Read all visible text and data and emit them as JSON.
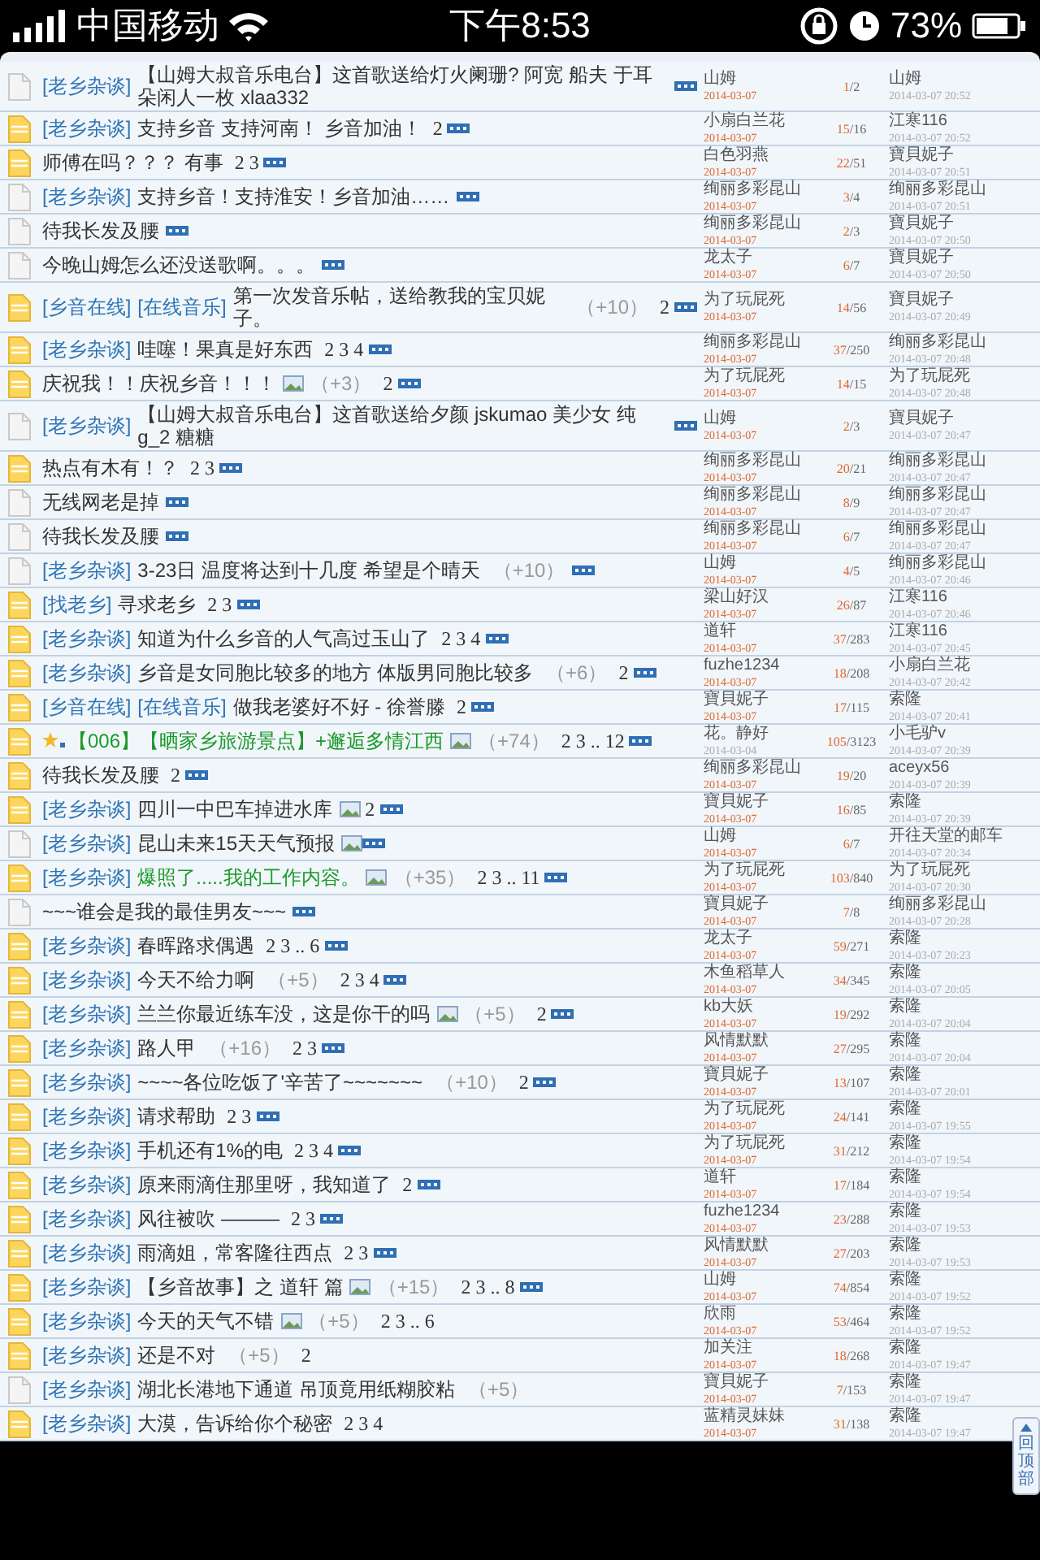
{
  "status_bar": {
    "carrier": "中国移动",
    "time": "下午8:53",
    "battery": "73%"
  },
  "rows": [
    {
      "kind": "plain",
      "tags": [
        "[老乡杂谈]"
      ],
      "title": "【山姆大叔音乐电台】这首歌送给灯火阑珊? 阿宽 船夫 于耳朵闲人一枚 xlaa332",
      "highlight": false,
      "starred": false,
      "image": false,
      "bonus": "",
      "pages": "",
      "new": true,
      "author": "山姆",
      "recent": true,
      "author_date": "2014-03-07",
      "counts": "1/2",
      "last_user": "山姆",
      "last_time": "2014-03-07 20:52"
    },
    {
      "kind": "hot",
      "tags": [
        "[老乡杂谈]"
      ],
      "title": "支持乡音 支持河南！ 乡音加油！",
      "highlight": false,
      "starred": false,
      "image": false,
      "bonus": "",
      "pages": "2",
      "new": true,
      "author": "小扇白兰花",
      "recent": true,
      "author_date": "2014-03-07",
      "counts": "15/16",
      "last_user": "江寒116",
      "last_time": "2014-03-07 20:52"
    },
    {
      "kind": "hot",
      "tags": [],
      "title": "师傅在吗？？？ 有事",
      "highlight": false,
      "starred": false,
      "image": false,
      "bonus": "",
      "pages": "2 3",
      "new": true,
      "author": "白色羽燕",
      "recent": true,
      "author_date": "2014-03-07",
      "counts": "22/51",
      "last_user": "寶貝妮子",
      "last_time": "2014-03-07 20:51"
    },
    {
      "kind": "plain",
      "tags": [
        "[老乡杂谈]"
      ],
      "title": "支持乡音！支持淮安！乡音加油……",
      "highlight": false,
      "starred": false,
      "image": false,
      "bonus": "",
      "pages": "",
      "new": true,
      "author": "绚丽多彩昆山",
      "recent": true,
      "author_date": "2014-03-07",
      "counts": "3/4",
      "last_user": "绚丽多彩昆山",
      "last_time": "2014-03-07 20:51"
    },
    {
      "kind": "plain",
      "tags": [],
      "title": "待我长发及腰",
      "highlight": false,
      "starred": false,
      "image": false,
      "bonus": "",
      "pages": "",
      "new": true,
      "author": "绚丽多彩昆山",
      "recent": true,
      "author_date": "2014-03-07",
      "counts": "2/3",
      "last_user": "寶貝妮子",
      "last_time": "2014-03-07 20:50"
    },
    {
      "kind": "plain",
      "tags": [],
      "title": "今晚山姆怎么还没送歌啊。。。",
      "highlight": false,
      "starred": false,
      "image": false,
      "bonus": "",
      "pages": "",
      "new": true,
      "author": "龙太子",
      "recent": true,
      "author_date": "2014-03-07",
      "counts": "6/7",
      "last_user": "寶貝妮子",
      "last_time": "2014-03-07 20:50"
    },
    {
      "kind": "hot",
      "tags": [
        "[乡音在线]",
        "[在线音乐]"
      ],
      "title": "第一次发音乐帖，送给教我的宝贝妮子。",
      "highlight": false,
      "starred": false,
      "image": false,
      "bonus": "（+10）",
      "pages": "2",
      "new": true,
      "author": "为了玩屁死",
      "recent": true,
      "author_date": "2014-03-07",
      "counts": "14/56",
      "last_user": "寶貝妮子",
      "last_time": "2014-03-07 20:49"
    },
    {
      "kind": "hot",
      "tags": [
        "[老乡杂谈]"
      ],
      "title": "哇噻！果真是好东西",
      "highlight": false,
      "starred": false,
      "image": false,
      "bonus": "",
      "pages": "2 3 4",
      "new": true,
      "author": "绚丽多彩昆山",
      "recent": true,
      "author_date": "2014-03-07",
      "counts": "37/250",
      "last_user": "绚丽多彩昆山",
      "last_time": "2014-03-07 20:48"
    },
    {
      "kind": "hot",
      "tags": [],
      "title": "庆祝我！！庆祝乡音！！！",
      "highlight": false,
      "starred": false,
      "image": true,
      "bonus": "（+3）",
      "pages": "2",
      "new": true,
      "author": "为了玩屁死",
      "recent": true,
      "author_date": "2014-03-07",
      "counts": "14/15",
      "last_user": "为了玩屁死",
      "last_time": "2014-03-07 20:48"
    },
    {
      "kind": "plain",
      "tags": [
        "[老乡杂谈]"
      ],
      "title": "【山姆大叔音乐电台】这首歌送给夕颜 jskumao 美少女 纯g_2 糖糖",
      "highlight": false,
      "starred": false,
      "image": false,
      "bonus": "",
      "pages": "",
      "new": true,
      "author": "山姆",
      "recent": true,
      "author_date": "2014-03-07",
      "counts": "2/3",
      "last_user": "寶貝妮子",
      "last_time": "2014-03-07 20:47"
    },
    {
      "kind": "hot",
      "tags": [],
      "title": "热点有木有！？",
      "highlight": false,
      "starred": false,
      "image": false,
      "bonus": "",
      "pages": "2 3",
      "new": true,
      "author": "绚丽多彩昆山",
      "recent": true,
      "author_date": "2014-03-07",
      "counts": "20/21",
      "last_user": "绚丽多彩昆山",
      "last_time": "2014-03-07 20:47"
    },
    {
      "kind": "plain",
      "tags": [],
      "title": "无线网老是掉",
      "highlight": false,
      "starred": false,
      "image": false,
      "bonus": "",
      "pages": "",
      "new": true,
      "author": "绚丽多彩昆山",
      "recent": true,
      "author_date": "2014-03-07",
      "counts": "8/9",
      "last_user": "绚丽多彩昆山",
      "last_time": "2014-03-07 20:47"
    },
    {
      "kind": "plain",
      "tags": [],
      "title": "待我长发及腰",
      "highlight": false,
      "starred": false,
      "image": false,
      "bonus": "",
      "pages": "",
      "new": true,
      "author": "绚丽多彩昆山",
      "recent": true,
      "author_date": "2014-03-07",
      "counts": "6/7",
      "last_user": "绚丽多彩昆山",
      "last_time": "2014-03-07 20:47"
    },
    {
      "kind": "plain",
      "tags": [
        "[老乡杂谈]"
      ],
      "title": "3-23日 温度将达到十几度 希望是个晴天",
      "highlight": false,
      "starred": false,
      "image": false,
      "bonus": "（+10）",
      "pages": "",
      "new": true,
      "author": "山姆",
      "recent": true,
      "author_date": "2014-03-07",
      "counts": "4/5",
      "last_user": "绚丽多彩昆山",
      "last_time": "2014-03-07 20:46"
    },
    {
      "kind": "hot",
      "tags": [
        "[找老乡]"
      ],
      "title": "寻求老乡",
      "highlight": false,
      "starred": false,
      "image": false,
      "bonus": "",
      "pages": "2 3",
      "new": true,
      "author": "梁山好汉",
      "recent": true,
      "author_date": "2014-03-07",
      "counts": "26/87",
      "last_user": "江寒116",
      "last_time": "2014-03-07 20:46"
    },
    {
      "kind": "hot",
      "tags": [
        "[老乡杂谈]"
      ],
      "title": "知道为什么乡音的人气高过玉山了",
      "highlight": false,
      "starred": false,
      "image": false,
      "bonus": "",
      "pages": "2 3 4",
      "new": true,
      "author": "道轩",
      "recent": true,
      "author_date": "2014-03-07",
      "counts": "37/283",
      "last_user": "江寒116",
      "last_time": "2014-03-07 20:45"
    },
    {
      "kind": "hot",
      "tags": [
        "[老乡杂谈]"
      ],
      "title": "乡音是女同胞比较多的地方 体版男同胞比较多",
      "highlight": false,
      "starred": false,
      "image": false,
      "bonus": "（+6）",
      "pages": "2",
      "new": true,
      "author": "fuzhe1234",
      "recent": true,
      "author_date": "2014-03-07",
      "counts": "18/208",
      "last_user": "小扇白兰花",
      "last_time": "2014-03-07 20:42"
    },
    {
      "kind": "hot",
      "tags": [
        "[乡音在线]",
        "[在线音乐]"
      ],
      "title": "做我老婆好不好 - 徐誉滕",
      "highlight": false,
      "starred": false,
      "image": false,
      "bonus": "",
      "pages": "2",
      "new": true,
      "author": "寶貝妮子",
      "recent": true,
      "author_date": "2014-03-07",
      "counts": "17/115",
      "last_user": "索隆",
      "last_time": "2014-03-07 20:41"
    },
    {
      "kind": "hot",
      "tags": [],
      "title": "【006】【晒家乡旅游景点】+邂逅多情江西",
      "highlight": true,
      "starred": true,
      "image": true,
      "bonus": "（+74）",
      "pages": "2 3 .. 12",
      "new": true,
      "author": "花。静好",
      "recent": false,
      "author_date": "2014-03-04",
      "counts": "105/3123",
      "last_user": "小毛驴v",
      "last_time": "2014-03-07 20:39"
    },
    {
      "kind": "hot",
      "tags": [],
      "title": "待我长发及腰",
      "highlight": false,
      "starred": false,
      "image": false,
      "bonus": "",
      "pages": "2",
      "new": true,
      "author": "绚丽多彩昆山",
      "recent": true,
      "author_date": "2014-03-07",
      "counts": "19/20",
      "last_user": "aceyx56",
      "last_time": "2014-03-07 20:39"
    },
    {
      "kind": "hot",
      "tags": [
        "[老乡杂谈]"
      ],
      "title": "四川一中巴车掉进水库",
      "highlight": false,
      "starred": false,
      "image": true,
      "bonus": "",
      "pages": "2",
      "new": true,
      "author": "寶貝妮子",
      "recent": true,
      "author_date": "2014-03-07",
      "counts": "16/85",
      "last_user": "索隆",
      "last_time": "2014-03-07 20:39"
    },
    {
      "kind": "plain",
      "tags": [
        "[老乡杂谈]"
      ],
      "title": "昆山未来15天天气预报",
      "highlight": false,
      "starred": false,
      "image": true,
      "bonus": "",
      "pages": "",
      "new": true,
      "author": "山姆",
      "recent": true,
      "author_date": "2014-03-07",
      "counts": "6/7",
      "last_user": "开往天堂的邮车",
      "last_time": "2014-03-07 20:34"
    },
    {
      "kind": "hot",
      "tags": [
        "[老乡杂谈]"
      ],
      "title": "爆照了.....我的工作内容。",
      "highlight": true,
      "starred": false,
      "image": true,
      "bonus": "（+35）",
      "pages": "2 3 .. 11",
      "new": true,
      "author": "为了玩屁死",
      "recent": true,
      "author_date": "2014-03-07",
      "counts": "103/840",
      "last_user": "为了玩屁死",
      "last_time": "2014-03-07 20:30"
    },
    {
      "kind": "plain",
      "tags": [],
      "title": "~~~谁会是我的最佳男友~~~",
      "highlight": false,
      "starred": false,
      "image": false,
      "bonus": "",
      "pages": "",
      "new": true,
      "author": "寶貝妮子",
      "recent": true,
      "author_date": "2014-03-07",
      "counts": "7/8",
      "last_user": "绚丽多彩昆山",
      "last_time": "2014-03-07 20:28"
    },
    {
      "kind": "hot",
      "tags": [
        "[老乡杂谈]"
      ],
      "title": "春晖路求偶遇",
      "highlight": false,
      "starred": false,
      "image": false,
      "bonus": "",
      "pages": "2 3 .. 6",
      "new": true,
      "author": "龙太子",
      "recent": true,
      "author_date": "2014-03-07",
      "counts": "59/271",
      "last_user": "索隆",
      "last_time": "2014-03-07 20:23"
    },
    {
      "kind": "hot",
      "tags": [
        "[老乡杂谈]"
      ],
      "title": "今天不给力啊",
      "highlight": false,
      "starred": false,
      "image": false,
      "bonus": "（+5）",
      "pages": "2 3 4",
      "new": true,
      "author": "木鱼稻草人",
      "recent": true,
      "author_date": "2014-03-07",
      "counts": "34/345",
      "last_user": "索隆",
      "last_time": "2014-03-07 20:05"
    },
    {
      "kind": "hot",
      "tags": [
        "[老乡杂谈]"
      ],
      "title": "兰兰你最近练车没，这是你干的吗",
      "highlight": false,
      "starred": false,
      "image": true,
      "bonus": "（+5）",
      "pages": "2",
      "new": true,
      "author": "kb大妖",
      "recent": true,
      "author_date": "2014-03-07",
      "counts": "19/292",
      "last_user": "索隆",
      "last_time": "2014-03-07 20:04"
    },
    {
      "kind": "hot",
      "tags": [
        "[老乡杂谈]"
      ],
      "title": "路人甲",
      "highlight": false,
      "starred": false,
      "image": false,
      "bonus": "（+16）",
      "pages": "2 3",
      "new": true,
      "author": "风情默默",
      "recent": true,
      "author_date": "2014-03-07",
      "counts": "27/295",
      "last_user": "索隆",
      "last_time": "2014-03-07 20:04"
    },
    {
      "kind": "hot",
      "tags": [
        "[老乡杂谈]"
      ],
      "title": "~~~~各位吃饭了'辛苦了~~~~~~~",
      "highlight": false,
      "starred": false,
      "image": false,
      "bonus": "（+10）",
      "pages": "2",
      "new": true,
      "author": "寶貝妮子",
      "recent": true,
      "author_date": "2014-03-07",
      "counts": "13/107",
      "last_user": "索隆",
      "last_time": "2014-03-07 20:01"
    },
    {
      "kind": "hot",
      "tags": [
        "[老乡杂谈]"
      ],
      "title": "请求帮助",
      "highlight": false,
      "starred": false,
      "image": false,
      "bonus": "",
      "pages": "2 3",
      "new": true,
      "author": "为了玩屁死",
      "recent": true,
      "author_date": "2014-03-07",
      "counts": "24/141",
      "last_user": "索隆",
      "last_time": "2014-03-07 19:55"
    },
    {
      "kind": "hot",
      "tags": [
        "[老乡杂谈]"
      ],
      "title": "手机还有1%的电",
      "highlight": false,
      "starred": false,
      "image": false,
      "bonus": "",
      "pages": "2 3 4",
      "new": true,
      "author": "为了玩屁死",
      "recent": true,
      "author_date": "2014-03-07",
      "counts": "31/212",
      "last_user": "索隆",
      "last_time": "2014-03-07 19:54"
    },
    {
      "kind": "hot",
      "tags": [
        "[老乡杂谈]"
      ],
      "title": "原来雨滴住那里呀，我知道了",
      "highlight": false,
      "starred": false,
      "image": false,
      "bonus": "",
      "pages": "2",
      "new": true,
      "author": "道轩",
      "recent": true,
      "author_date": "2014-03-07",
      "counts": "17/184",
      "last_user": "索隆",
      "last_time": "2014-03-07 19:54"
    },
    {
      "kind": "hot",
      "tags": [
        "[老乡杂谈]"
      ],
      "title": "风往被吹 ———",
      "highlight": false,
      "starred": false,
      "image": false,
      "bonus": "",
      "pages": "2 3",
      "new": true,
      "author": "fuzhe1234",
      "recent": true,
      "author_date": "2014-03-07",
      "counts": "23/288",
      "last_user": "索隆",
      "last_time": "2014-03-07 19:53"
    },
    {
      "kind": "hot",
      "tags": [
        "[老乡杂谈]"
      ],
      "title": "雨滴姐，常客隆往西点",
      "highlight": false,
      "starred": false,
      "image": false,
      "bonus": "",
      "pages": "2 3",
      "new": true,
      "author": "风情默默",
      "recent": true,
      "author_date": "2014-03-07",
      "counts": "27/203",
      "last_user": "索隆",
      "last_time": "2014-03-07 19:53"
    },
    {
      "kind": "hot",
      "tags": [
        "[老乡杂谈]"
      ],
      "title": "【乡音故事】之 道轩 篇",
      "highlight": false,
      "starred": false,
      "image": true,
      "bonus": "（+15）",
      "pages": "2 3 .. 8",
      "new": true,
      "author": "山姆",
      "recent": true,
      "author_date": "2014-03-07",
      "counts": "74/854",
      "last_user": "索隆",
      "last_time": "2014-03-07 19:52"
    },
    {
      "kind": "hot",
      "tags": [
        "[老乡杂谈]"
      ],
      "title": "今天的天气不错",
      "highlight": false,
      "starred": false,
      "image": true,
      "bonus": "（+5）",
      "pages": "2 3 .. 6",
      "new": false,
      "author": "欣雨",
      "recent": true,
      "author_date": "2014-03-07",
      "counts": "53/464",
      "last_user": "索隆",
      "last_time": "2014-03-07 19:52"
    },
    {
      "kind": "hot",
      "tags": [
        "[老乡杂谈]"
      ],
      "title": "还是不对",
      "highlight": false,
      "starred": false,
      "image": false,
      "bonus": "（+5）",
      "pages": "2",
      "new": false,
      "author": "加关注",
      "recent": true,
      "author_date": "2014-03-07",
      "counts": "18/268",
      "last_user": "索隆",
      "last_time": "2014-03-07 19:47"
    },
    {
      "kind": "plain",
      "tags": [
        "[老乡杂谈]"
      ],
      "title": "湖北长港地下通道 吊顶竟用纸糊胶粘",
      "highlight": false,
      "starred": false,
      "image": false,
      "bonus": "（+5）",
      "pages": "",
      "new": false,
      "author": "寶貝妮子",
      "recent": true,
      "author_date": "2014-03-07",
      "counts": "7/153",
      "last_user": "索隆",
      "last_time": "2014-03-07 19:47"
    },
    {
      "kind": "hot",
      "tags": [
        "[老乡杂谈]"
      ],
      "title": "大漠，告诉给你个秘密",
      "highlight": false,
      "starred": false,
      "image": false,
      "bonus": "",
      "pages": "2 3 4",
      "new": false,
      "author": "蓝精灵妹妹",
      "recent": true,
      "author_date": "2014-03-07",
      "counts": "31/138",
      "last_user": "索隆",
      "last_time": "2014-03-07 19:47"
    }
  ],
  "back_to_top": "回顶部"
}
